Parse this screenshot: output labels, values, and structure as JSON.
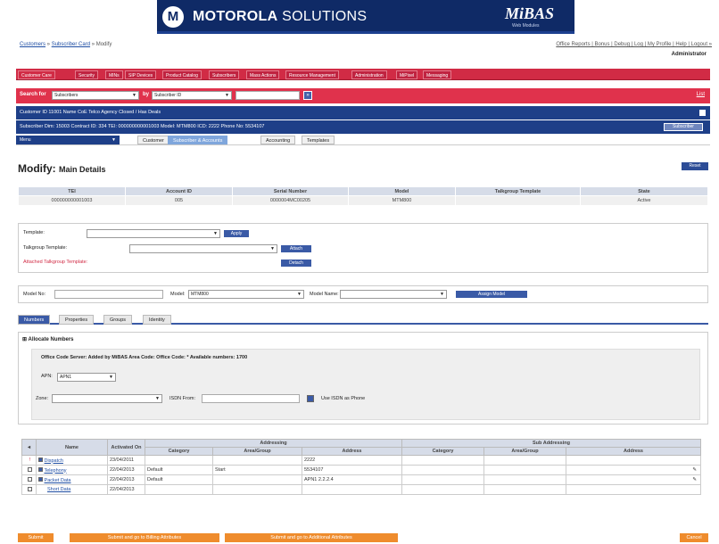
{
  "brand": {
    "logo_letter": "M",
    "name_bold": "MOTOROLA",
    "name_rest": " SOLUTIONS",
    "app": "MiBAS",
    "app_sub": "Web Modules"
  },
  "breadcrumb": {
    "link1": "Customers",
    "sep": " » ",
    "link2": "Subscriber Card",
    "tail": " » Modify"
  },
  "toplinks": "Office Reports | Bonus | Debug | Log | My Profile | Help | Logout »",
  "user": "Administrator",
  "main_tabs": [
    "Customer Care",
    "Security",
    "MINs",
    "SIP Devices",
    "Product Catalog",
    "Subscribers",
    "Mass Actions",
    "Resource Management",
    "Administration",
    "MiPixel",
    "Messaging"
  ],
  "search": {
    "label": "Search for",
    "type_value": "Subscribers",
    "by_label": "by",
    "field_value": "Subscriber ID",
    "query": "",
    "go": "»",
    "link": "List"
  },
  "customer_line": "Customer   ID 11001    Name   CoE Telco Agency    Closed / Has Deals",
  "subscriber_line": "Subscriber   Dim: 15003    Contract ID: 334    TEI: 000000000001003    Model: MTM800    ICD: 2222    Phone No: 5534107",
  "subscriber_btn": "Subscriber",
  "subnav": {
    "menu": "Menu",
    "tabs": [
      "Customer",
      "Subscriber & Accounts",
      "Accounting",
      "Templates"
    ]
  },
  "page_title": "Modify:",
  "page_subtitle": "Main Details",
  "reset": "Reset",
  "summary": {
    "headers": [
      "TEI",
      "Account ID",
      "Serial Number",
      "Model",
      "Talkgroup Template",
      "State"
    ],
    "row": [
      "000000000001003",
      "005",
      "0000004MC00205",
      "MTM800",
      "",
      "Active"
    ]
  },
  "templates": {
    "template_label": "Template:",
    "apply": "Apply",
    "talkgroup_label": "Talkgroup Template:",
    "attach": "Attach",
    "attached_label": "Attached Talkgroup Template:",
    "detach": "Detach"
  },
  "model": {
    "model_no_label": "Model No:",
    "model_label": "Model:",
    "model_value": "MTM800",
    "model_name_label": "Model Name:",
    "assign": "Assign Model"
  },
  "tabs2": [
    "Numbers",
    "Properties",
    "Groups",
    "Identity"
  ],
  "alloc": {
    "title": "Allocate Numbers",
    "office": "Office Code Server: Added by MiBAS   Area Code:   Office Code: *   Available numbers: 1700",
    "apn_label": "APN:",
    "apn_value": "APN1",
    "zone_label": "Zone:",
    "isdn_label": "ISDN From:",
    "use_isdn": "Use ISDN as Phone"
  },
  "numbers": {
    "headers1": [
      "",
      "Name",
      "Activated On",
      "Addressing",
      "Sub Addressing"
    ],
    "headers2": [
      "Category",
      "Area/Group",
      "Address",
      "Category",
      "Area/Group",
      "Address"
    ],
    "rows": [
      {
        "flag": "!",
        "name": "Dispatch",
        "date": "23/04/2011",
        "category": "",
        "area": "",
        "address": "2222",
        "editable": false
      },
      {
        "flag": "",
        "name": "Telephony",
        "date": "22/04/2013",
        "category": "Default",
        "area": "Start",
        "address": "5534107",
        "editable": true
      },
      {
        "flag": "",
        "name": "Packet Data",
        "date": "22/04/2013",
        "category": "Default",
        "area": "",
        "address": "APN1 2.2.2.4",
        "editable": true
      },
      {
        "flag": "",
        "name": "Short Data",
        "date": "22/04/2013",
        "category": "",
        "area": "",
        "address": "",
        "editable": false
      }
    ]
  },
  "footer": {
    "submit": "Submit",
    "goto_billing": "Submit and go to Billing Attributes",
    "goto_additional": "Submit and go to Additional Attributes",
    "cancel": "Cancel"
  },
  "colors": {
    "red": "#d12b45",
    "navy": "#1e3f88",
    "brand": "#0f2a66",
    "orange": "#ef8c2d"
  }
}
